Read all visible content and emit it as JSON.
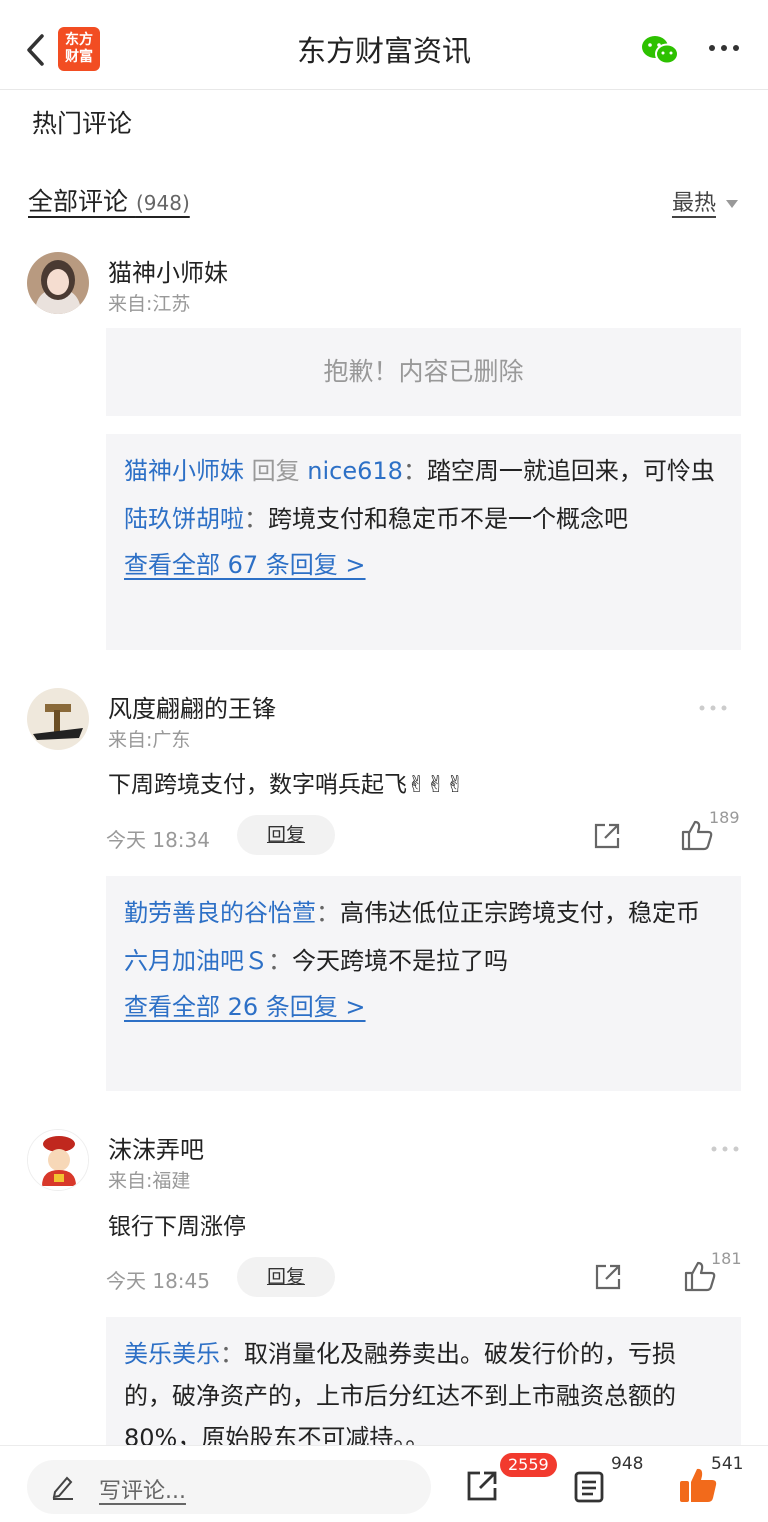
{
  "header": {
    "logo_text_line1": "东方",
    "logo_text_line2": "财富",
    "title": "东方财富资讯"
  },
  "sections": {
    "hot_label": "热门评论",
    "all_label": "全部评论",
    "all_count": "(948)",
    "sort_label": "最热"
  },
  "comments": [
    {
      "user": "猫神小师妹",
      "location": "来自:江苏",
      "deleted_text": "抱歉！内容已删除",
      "replies": [
        {
          "user": "猫神小师妹",
          "reply_word": "回复",
          "target": "nice618",
          "text": "踏空周一就追回来，可怜虫"
        },
        {
          "user": "陆玖饼胡啦",
          "text": "跨境支付和稳定币不是一个概念吧"
        }
      ],
      "view_all": "查看全部 67 条回复 >"
    },
    {
      "user": "风度翩翩的王锋",
      "location": "来自:广东",
      "text": "下周跨境支付，数字哨兵起飞✌✌✌",
      "time": "今天 18:34",
      "reply_label": "回复",
      "likes": "189",
      "replies": [
        {
          "user": "勤劳善良的谷怡萱",
          "text": "高伟达低位正宗跨境支付，稳定币"
        },
        {
          "user": "六月加油吧Ｓ",
          "text": "今天跨境不是拉了吗"
        }
      ],
      "view_all": "查看全部 26 条回复 >"
    },
    {
      "user": "沫沫弄吧",
      "location": "来自:福建",
      "text": "银行下周涨停",
      "time": "今天 18:45",
      "reply_label": "回复",
      "likes": "181",
      "replies": [
        {
          "user": "美乐美乐",
          "text": "取消量化及融券卖出。破发行价的，亏损的，破净资产的，上市后分红达不到上市融资总额的80%，原始股东不可减持。。"
        }
      ]
    }
  ],
  "bottom_bar": {
    "placeholder": "写评论...",
    "share_badge": "2559",
    "comment_count": "948",
    "like_count": "541"
  },
  "colors": {
    "accent_blue": "#2d70c6",
    "brand_orange": "#f24d22",
    "like_orange": "#f26a1b",
    "badge_red": "#f23a2e",
    "wechat_green": "#2dc100"
  }
}
